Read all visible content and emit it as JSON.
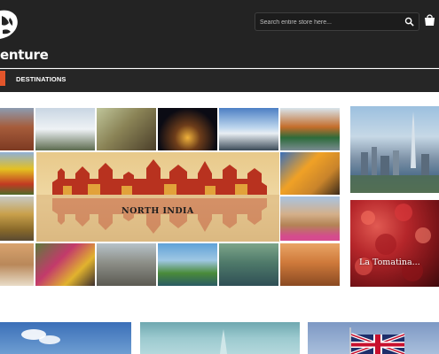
{
  "brand": {
    "logo_text": "enture"
  },
  "search": {
    "placeholder": "Search entire store here..."
  },
  "nav": {
    "items": [
      {
        "label": "DESTINATIONS"
      }
    ]
  },
  "banner": {
    "collage_label": "NORTH INDIA"
  },
  "promo": {
    "caption": "La Tomatina..."
  },
  "icons": {
    "search": "search-icon",
    "cart": "cart-icon",
    "logo": "globe-icon"
  },
  "colors": {
    "header_bg": "#232323",
    "nav_accent": "#e2552b",
    "page_bg": "#ffffff"
  }
}
